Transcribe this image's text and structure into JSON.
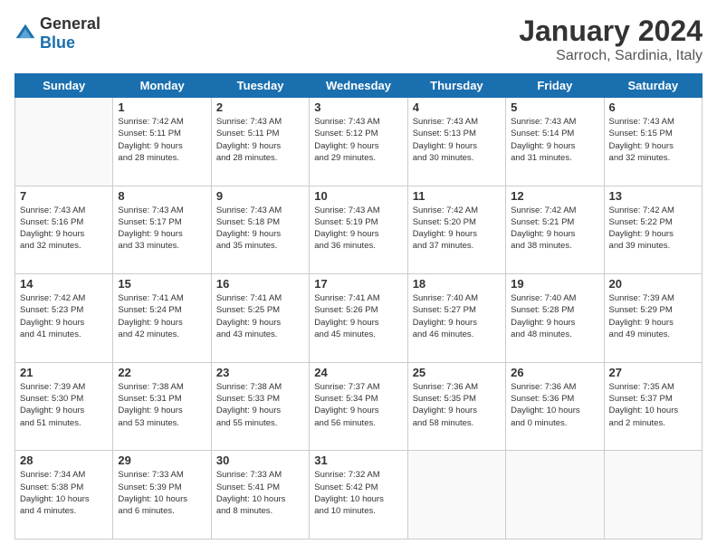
{
  "logo": {
    "general": "General",
    "blue": "Blue"
  },
  "header": {
    "title": "January 2024",
    "subtitle": "Sarroch, Sardinia, Italy"
  },
  "weekdays": [
    "Sunday",
    "Monday",
    "Tuesday",
    "Wednesday",
    "Thursday",
    "Friday",
    "Saturday"
  ],
  "weeks": [
    [
      {
        "day": "",
        "info": ""
      },
      {
        "day": "1",
        "info": "Sunrise: 7:42 AM\nSunset: 5:11 PM\nDaylight: 9 hours\nand 28 minutes."
      },
      {
        "day": "2",
        "info": "Sunrise: 7:43 AM\nSunset: 5:11 PM\nDaylight: 9 hours\nand 28 minutes."
      },
      {
        "day": "3",
        "info": "Sunrise: 7:43 AM\nSunset: 5:12 PM\nDaylight: 9 hours\nand 29 minutes."
      },
      {
        "day": "4",
        "info": "Sunrise: 7:43 AM\nSunset: 5:13 PM\nDaylight: 9 hours\nand 30 minutes."
      },
      {
        "day": "5",
        "info": "Sunrise: 7:43 AM\nSunset: 5:14 PM\nDaylight: 9 hours\nand 31 minutes."
      },
      {
        "day": "6",
        "info": "Sunrise: 7:43 AM\nSunset: 5:15 PM\nDaylight: 9 hours\nand 32 minutes."
      }
    ],
    [
      {
        "day": "7",
        "info": "Sunrise: 7:43 AM\nSunset: 5:16 PM\nDaylight: 9 hours\nand 32 minutes."
      },
      {
        "day": "8",
        "info": "Sunrise: 7:43 AM\nSunset: 5:17 PM\nDaylight: 9 hours\nand 33 minutes."
      },
      {
        "day": "9",
        "info": "Sunrise: 7:43 AM\nSunset: 5:18 PM\nDaylight: 9 hours\nand 35 minutes."
      },
      {
        "day": "10",
        "info": "Sunrise: 7:43 AM\nSunset: 5:19 PM\nDaylight: 9 hours\nand 36 minutes."
      },
      {
        "day": "11",
        "info": "Sunrise: 7:42 AM\nSunset: 5:20 PM\nDaylight: 9 hours\nand 37 minutes."
      },
      {
        "day": "12",
        "info": "Sunrise: 7:42 AM\nSunset: 5:21 PM\nDaylight: 9 hours\nand 38 minutes."
      },
      {
        "day": "13",
        "info": "Sunrise: 7:42 AM\nSunset: 5:22 PM\nDaylight: 9 hours\nand 39 minutes."
      }
    ],
    [
      {
        "day": "14",
        "info": "Sunrise: 7:42 AM\nSunset: 5:23 PM\nDaylight: 9 hours\nand 41 minutes."
      },
      {
        "day": "15",
        "info": "Sunrise: 7:41 AM\nSunset: 5:24 PM\nDaylight: 9 hours\nand 42 minutes."
      },
      {
        "day": "16",
        "info": "Sunrise: 7:41 AM\nSunset: 5:25 PM\nDaylight: 9 hours\nand 43 minutes."
      },
      {
        "day": "17",
        "info": "Sunrise: 7:41 AM\nSunset: 5:26 PM\nDaylight: 9 hours\nand 45 minutes."
      },
      {
        "day": "18",
        "info": "Sunrise: 7:40 AM\nSunset: 5:27 PM\nDaylight: 9 hours\nand 46 minutes."
      },
      {
        "day": "19",
        "info": "Sunrise: 7:40 AM\nSunset: 5:28 PM\nDaylight: 9 hours\nand 48 minutes."
      },
      {
        "day": "20",
        "info": "Sunrise: 7:39 AM\nSunset: 5:29 PM\nDaylight: 9 hours\nand 49 minutes."
      }
    ],
    [
      {
        "day": "21",
        "info": "Sunrise: 7:39 AM\nSunset: 5:30 PM\nDaylight: 9 hours\nand 51 minutes."
      },
      {
        "day": "22",
        "info": "Sunrise: 7:38 AM\nSunset: 5:31 PM\nDaylight: 9 hours\nand 53 minutes."
      },
      {
        "day": "23",
        "info": "Sunrise: 7:38 AM\nSunset: 5:33 PM\nDaylight: 9 hours\nand 55 minutes."
      },
      {
        "day": "24",
        "info": "Sunrise: 7:37 AM\nSunset: 5:34 PM\nDaylight: 9 hours\nand 56 minutes."
      },
      {
        "day": "25",
        "info": "Sunrise: 7:36 AM\nSunset: 5:35 PM\nDaylight: 9 hours\nand 58 minutes."
      },
      {
        "day": "26",
        "info": "Sunrise: 7:36 AM\nSunset: 5:36 PM\nDaylight: 10 hours\nand 0 minutes."
      },
      {
        "day": "27",
        "info": "Sunrise: 7:35 AM\nSunset: 5:37 PM\nDaylight: 10 hours\nand 2 minutes."
      }
    ],
    [
      {
        "day": "28",
        "info": "Sunrise: 7:34 AM\nSunset: 5:38 PM\nDaylight: 10 hours\nand 4 minutes."
      },
      {
        "day": "29",
        "info": "Sunrise: 7:33 AM\nSunset: 5:39 PM\nDaylight: 10 hours\nand 6 minutes."
      },
      {
        "day": "30",
        "info": "Sunrise: 7:33 AM\nSunset: 5:41 PM\nDaylight: 10 hours\nand 8 minutes."
      },
      {
        "day": "31",
        "info": "Sunrise: 7:32 AM\nSunset: 5:42 PM\nDaylight: 10 hours\nand 10 minutes."
      },
      {
        "day": "",
        "info": ""
      },
      {
        "day": "",
        "info": ""
      },
      {
        "day": "",
        "info": ""
      }
    ]
  ]
}
